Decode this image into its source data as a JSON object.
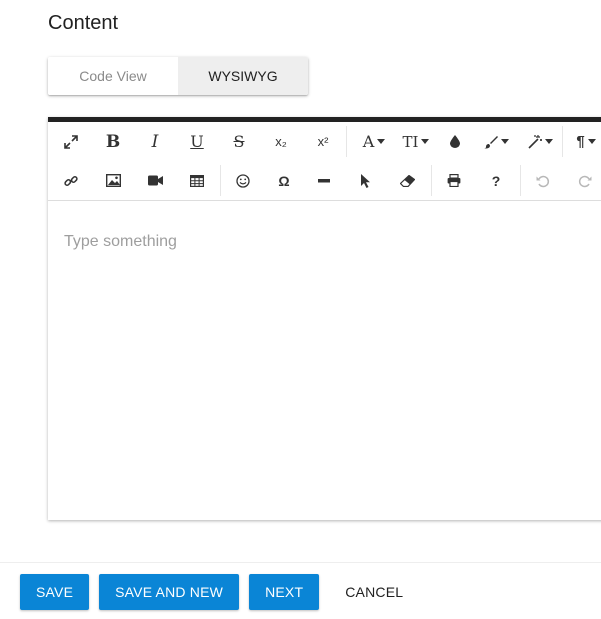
{
  "section_title": "Content",
  "view_toggle": {
    "code_view_label": "Code View",
    "wysiwyg_label": "WYSIWYG",
    "active": "WYSIWYG"
  },
  "toolbar": {
    "row1": [
      "fullscreen-icon",
      "bold-icon",
      "italic-icon",
      "underline-icon",
      "strikethrough-icon",
      "subscript-icon",
      "superscript-icon",
      "font-family-icon",
      "font-size-icon",
      "color-icon",
      "paragraph-style-icon",
      "inline-style-icon",
      "paragraph-format-icon"
    ],
    "row2": [
      "link-icon",
      "image-icon",
      "video-icon",
      "table-icon",
      "emoticons-icon",
      "special-characters-icon",
      "horizontal-line-icon",
      "select-all-icon",
      "clear-formatting-icon",
      "print-icon",
      "help-icon",
      "undo-icon",
      "redo-icon"
    ],
    "font_family_glyph": "A",
    "font_size_glyph": "TI",
    "subscript_glyph": "x₂",
    "superscript_glyph": "x²",
    "omega_glyph": "Ω",
    "help_glyph": "?",
    "paragraph_glyph": "¶"
  },
  "editor": {
    "placeholder": "Type something"
  },
  "footer": {
    "save_label": "SAVE",
    "save_and_new_label": "SAVE AND NEW",
    "next_label": "NEXT",
    "cancel_label": "CANCEL"
  },
  "colors": {
    "primary": "#0a85d6",
    "toolbar_top_border": "#222222",
    "placeholder": "#9e9e9e"
  }
}
